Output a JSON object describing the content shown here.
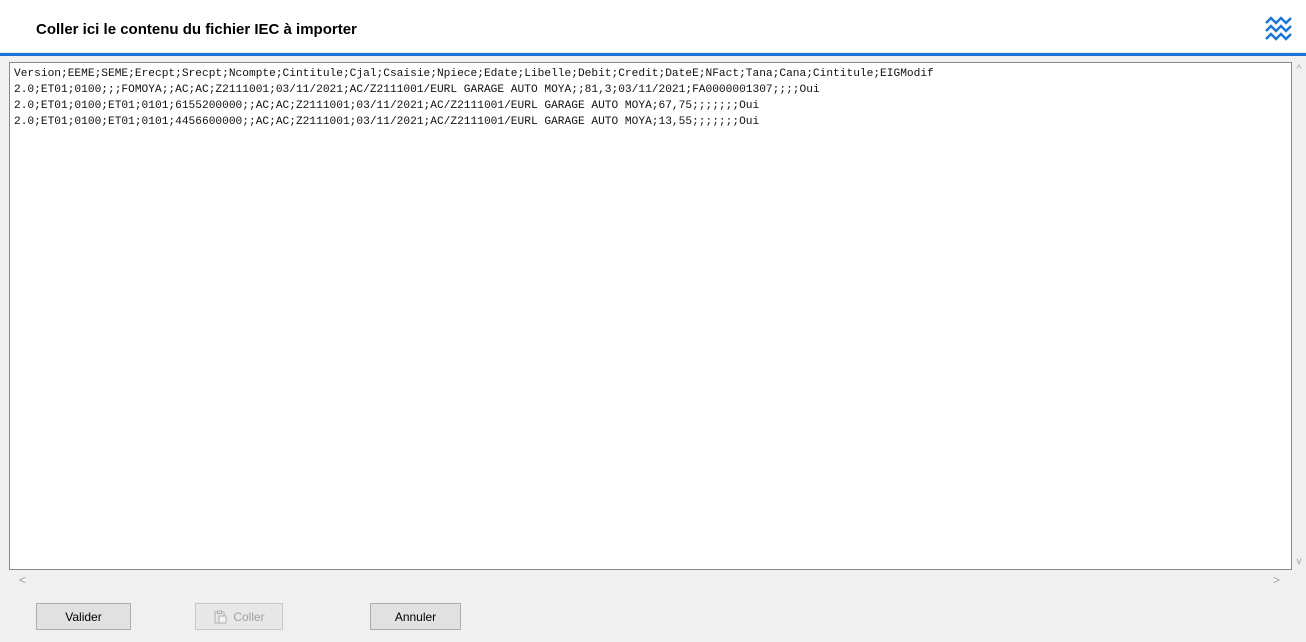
{
  "dialog": {
    "title": "Coller ici le contenu du fichier IEC à importer",
    "accent_color": "#1a73d9",
    "logo_icon": "wave-logo-icon"
  },
  "editor": {
    "lines": [
      "Version;EEME;SEME;Erecpt;Srecpt;Ncompte;Cintitule;Cjal;Csaisie;Npiece;Edate;Libelle;Debit;Credit;DateE;NFact;Tana;Cana;Cintitule;EIGModif",
      "2.0;ET01;0100;;;FOMOYA;;AC;AC;Z2111001;03/11/2021;AC/Z2111001/EURL GARAGE AUTO MOYA;;81,3;03/11/2021;FA0000001307;;;;Oui",
      "2.0;ET01;0100;ET01;0101;6155200000;;AC;AC;Z2111001;03/11/2021;AC/Z2111001/EURL GARAGE AUTO MOYA;67,75;;;;;;;Oui",
      "2.0;ET01;0100;ET01;0101;4456600000;;AC;AC;Z2111001;03/11/2021;AC/Z2111001/EURL GARAGE AUTO MOYA;13,55;;;;;;;Oui"
    ]
  },
  "buttons": {
    "valider": "Valider",
    "coller": "Coller",
    "annuler": "Annuler"
  }
}
